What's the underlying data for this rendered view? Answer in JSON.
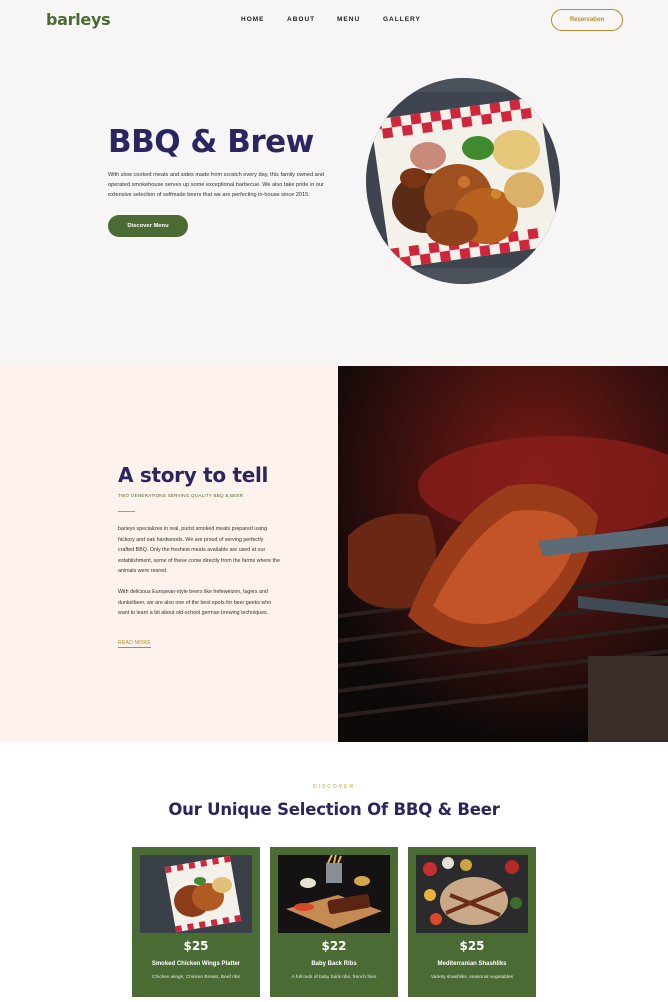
{
  "header": {
    "logo": "barleys",
    "nav": [
      "HOME",
      "ABOUT",
      "MENU",
      "GALLERY"
    ],
    "reservation_label": "Reservation"
  },
  "hero": {
    "title": "BBQ & Brew",
    "text": "With slow cooked meats and sides made from scratch every day, this family owned and operated smokehouse serves up some exceptional barbecue. We also take pride in our extensive selection of selfmade beers that we are perfecting in-house since 2015.",
    "button_label": "Discover Menu"
  },
  "story": {
    "title": "A story to tell",
    "subtitle": "TWO GENERATIONS SERVING QUALITY BBQ & BEER",
    "paragraph1": "barleys specializes in real, purist smoked meats prepared using hickory and oak hardwoods. We are proud of serving perfectly crafted BBQ. Only the freshest meats available are used at our establishment, some of these come directly from the farms where the animals were reared.",
    "paragraph2": "With delicious European-style beers like hefeweizen, lagers and dunkelbeer, we are also one of the best spots for beer geeks who want to learn a bit about old-school german brewing techniques.",
    "read_more": "READ MORE"
  },
  "selection": {
    "eyebrow": "DISCOVER",
    "title": "Our Unique Selection Of BBQ & Beer",
    "cards": [
      {
        "price": "$25",
        "name": "Smoked Chicken Wings Platter",
        "desc": "Chicken wings, Chicken Breast, Beef ribs"
      },
      {
        "price": "$22",
        "name": "Baby Back Ribs",
        "desc": "A full rack of baby back ribs, french fries"
      },
      {
        "price": "$25",
        "name": "Mediterranian Shashliks",
        "desc": "Variety shashliks, seasonal vegetables"
      }
    ]
  },
  "colors": {
    "brand_green": "#4b6b35",
    "accent_gold": "#b8892a",
    "heading_navy": "#2b2660",
    "hero_bg": "#f7f5f6",
    "story_bg": "#fdf3ec"
  }
}
